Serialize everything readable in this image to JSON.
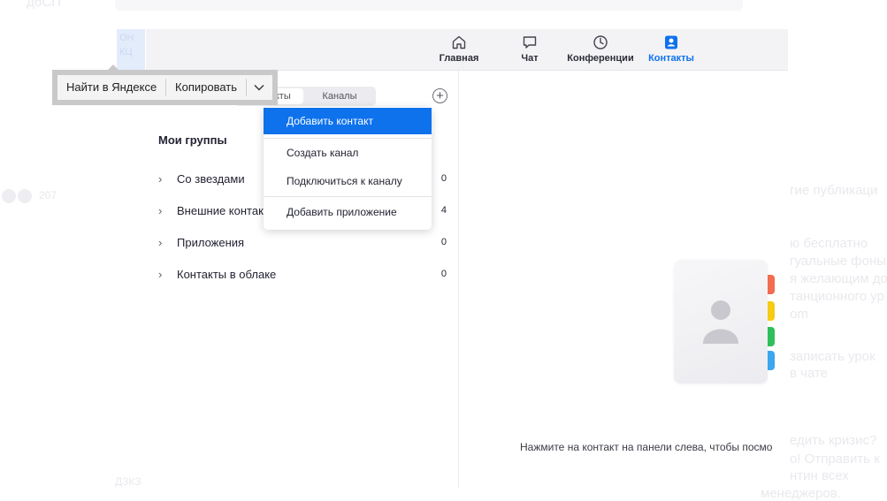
{
  "background_page": {
    "fragments": [
      "дбСП",
      "207",
      "гие публикаци",
      "ю бесплатно",
      "гуальные фоны",
      "я желающим до",
      "танционного ур",
      "om",
      "записать урок",
      "в чате",
      "едить кризис?",
      "о! Отправить к",
      "нтин всех",
      "менеджеров.",
      "ОН",
      "КЦ",
      "ДЗКЗ"
    ]
  },
  "nav": {
    "items": [
      {
        "label": "Главная",
        "icon": "home-icon"
      },
      {
        "label": "Чат",
        "icon": "chat-icon"
      },
      {
        "label": "Конференции",
        "icon": "clock-icon"
      },
      {
        "label": "Контакты",
        "icon": "contacts-icon"
      }
    ],
    "active": "Контакты",
    "accent_color": "#0e72ed"
  },
  "left_pane": {
    "tabs": [
      "Контакты",
      "Каналы"
    ],
    "add_icon": "plus-circle-icon",
    "groups_title": "Мои группы",
    "groups": [
      {
        "name": "Со звездами",
        "count": "0"
      },
      {
        "name": "Внешние контакты",
        "count": "4"
      },
      {
        "name": "Приложения",
        "count": "0"
      },
      {
        "name": "Контакты в облаке",
        "count": "0"
      }
    ]
  },
  "dropdown": {
    "items": [
      "Добавить контакт",
      "Создать канал",
      "Подключиться к каналу",
      "Добавить приложение"
    ],
    "highlighted": "Добавить контакт"
  },
  "right_pane": {
    "hint": "Нажмите на контакт на панели слева, чтобы посмо",
    "illustration": "address-book-icon",
    "tab_colors": [
      "#f26c4f",
      "#f5cb14",
      "#2fbf5a",
      "#3aa7ee"
    ]
  },
  "selection_popup": {
    "search_label": "Найти в Яндексе",
    "copy_label": "Копировать",
    "more_icon": "chevron-down-icon"
  }
}
